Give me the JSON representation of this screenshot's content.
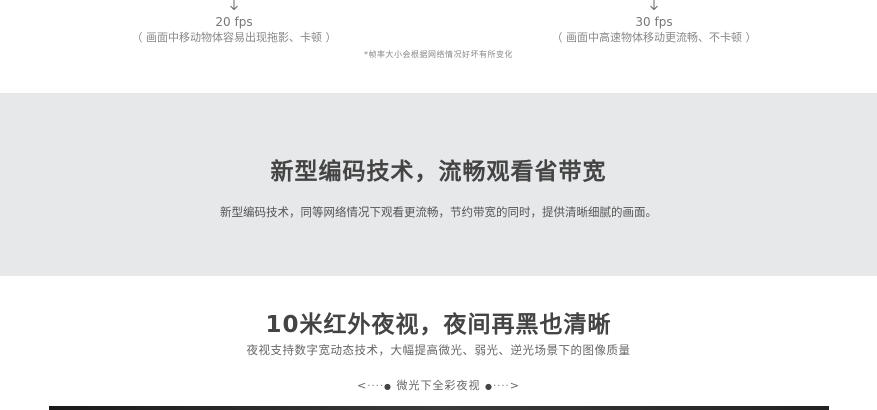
{
  "fps": {
    "left": {
      "value": "20 fps",
      "desc": "（ 画面中移动物体容易出现拖影、卡顿 ）"
    },
    "right": {
      "value": "30 fps",
      "desc": "（ 画面中高速物体移动更流畅、不卡顿 ）"
    },
    "note": "*帧率大小会根据网络情况好坏有所变化"
  },
  "codec": {
    "title": "新型编码技术，流畅观看省带宽",
    "desc": "新型编码技术，同等网络情况下观看更流畅，节约带宽的同时，提供清晰细腻的画面。"
  },
  "night": {
    "title": "10米红外夜视，夜间再黑也清晰",
    "desc": "夜视支持数字宽动态技术，大幅提高微光、弱光、逆光场景下的图像质量",
    "toggle_left_arrow": "<",
    "toggle_left_dots": "····",
    "toggle_label": "微光下全彩夜视",
    "toggle_right_dots": "····",
    "toggle_right_arrow": ">"
  }
}
